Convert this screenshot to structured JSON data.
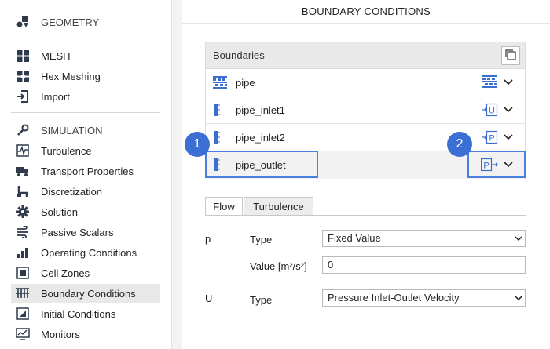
{
  "sidebar": {
    "items": [
      {
        "label": "GEOMETRY",
        "icon": "geometry-icon"
      },
      {
        "label": "MESH",
        "icon": "mesh-icon"
      },
      {
        "label": "Hex Meshing",
        "icon": "hex-meshing-icon"
      },
      {
        "label": "Import",
        "icon": "import-icon"
      },
      {
        "label": "SIMULATION",
        "icon": "wrench-icon"
      },
      {
        "label": "Turbulence",
        "icon": "turbulence-icon"
      },
      {
        "label": "Transport Properties",
        "icon": "transport-icon"
      },
      {
        "label": "Discretization",
        "icon": "discretization-icon"
      },
      {
        "label": "Solution",
        "icon": "gear-icon"
      },
      {
        "label": "Passive Scalars",
        "icon": "scalars-icon"
      },
      {
        "label": "Operating Conditions",
        "icon": "operating-icon"
      },
      {
        "label": "Cell Zones",
        "icon": "cell-zones-icon"
      },
      {
        "label": "Boundary Conditions",
        "icon": "boundary-icon"
      },
      {
        "label": "Initial Conditions",
        "icon": "initial-icon"
      },
      {
        "label": "Monitors",
        "icon": "monitors-icon"
      }
    ]
  },
  "main": {
    "title": "BOUNDARY CONDITIONS",
    "boundaries_header": "Boundaries",
    "boundaries": [
      {
        "name": "pipe",
        "type_icon": "wall-icon"
      },
      {
        "name": "pipe_inlet1",
        "type_icon": "velocity-inlet-icon",
        "type_letter": "U"
      },
      {
        "name": "pipe_inlet2",
        "type_icon": "pressure-inlet-icon",
        "type_letter": "P"
      },
      {
        "name": "pipe_outlet",
        "type_icon": "pressure-outlet-icon",
        "type_letter": "P"
      }
    ],
    "callouts": [
      "1",
      "2"
    ],
    "tabs": [
      "Flow",
      "Turbulence"
    ],
    "p": {
      "label": "p",
      "type_label": "Type",
      "type_value": "Fixed Value",
      "value_label": "Value [m²/s²]",
      "value": "0"
    },
    "U": {
      "label": "U",
      "type_label": "Type",
      "type_value": "Pressure Inlet-Outlet Velocity"
    }
  },
  "colors": {
    "accent": "#3c6fd4",
    "highlight_border": "#4a7ee0",
    "icon_blue": "#3a6fd0"
  }
}
